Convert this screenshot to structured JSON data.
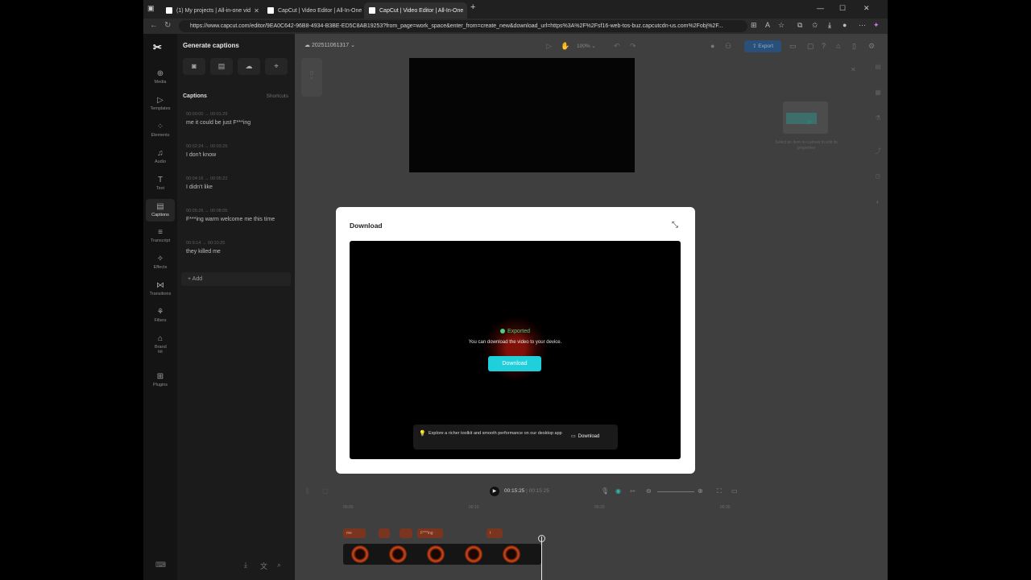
{
  "browser": {
    "tabs": [
      {
        "label": "(1)  My projects | All-in-one vid",
        "active": false
      },
      {
        "label": "CapCut | Video Editor | All-In-One",
        "active": false
      },
      {
        "label": "CapCut | Video Editor | All-In-One",
        "active": true
      }
    ],
    "new_tab": "+",
    "url": "https://www.capcut.com/editor/9EA0C642-96B8-4934-B3BE-ED5C8AB19253?from_page=work_space&enter_from=create_new&download_url=https%3A%2F%2Fsf16-web-tos-buz.capcutcdn-us.com%2Fobj%2F..."
  },
  "rail": {
    "items": [
      {
        "label": "Media",
        "icon": "media-icon"
      },
      {
        "label": "Templates",
        "icon": "templates-icon"
      },
      {
        "label": "Elements",
        "icon": "elements-icon"
      },
      {
        "label": "Audio",
        "icon": "audio-icon"
      },
      {
        "label": "Text",
        "icon": "text-icon"
      },
      {
        "label": "Captions",
        "icon": "captions-icon",
        "active": true
      },
      {
        "label": "Transcript",
        "icon": "transcript-icon"
      },
      {
        "label": "Effects",
        "icon": "effects-icon"
      },
      {
        "label": "Transitions",
        "icon": "transitions-icon"
      },
      {
        "label": "Filters",
        "icon": "filters-icon"
      },
      {
        "label": "Brand kit",
        "icon": "brand-kit-icon"
      },
      {
        "label": "Plugins",
        "icon": "plugins-icon"
      }
    ]
  },
  "captions_panel": {
    "title": "Generate captions",
    "section": "Captions",
    "shortcuts": "Shortcuts",
    "items": [
      {
        "time": "00:00:00 → 00:01:29",
        "text": "me it could be just F***ing"
      },
      {
        "time": "00:02:24 → 00:03:25",
        "text": "I don't know"
      },
      {
        "time": "00:04:16 → 00:05:22",
        "text": "I didn't like"
      },
      {
        "time": "00:05:26 → 00:08:05",
        "text": "F***ing warm welcome me this time"
      },
      {
        "time": "00:9:14 → 00:10:25",
        "text": "they killed me"
      }
    ],
    "add_label": "Add"
  },
  "toolbar": {
    "project_name": "202511061317",
    "zoom": "100%",
    "export_label": "Export"
  },
  "right_panel": {
    "hint": "Select an item on canvas to edit its properties"
  },
  "timeline": {
    "current": "00:15:25",
    "separator": "|",
    "total": "00:15:25",
    "ruler": [
      "00:00",
      "00:10",
      "00:20",
      "00:30"
    ],
    "caption_clips": [
      "me",
      "",
      "",
      "F***ing",
      "t"
    ]
  },
  "modal": {
    "title": "Download",
    "status": "Exported",
    "message": "You can download the video to your device.",
    "download_label": "Download",
    "promo_text": "Explore a richer toolkit and smooth performance on our desktop app",
    "promo_download": "Download"
  }
}
